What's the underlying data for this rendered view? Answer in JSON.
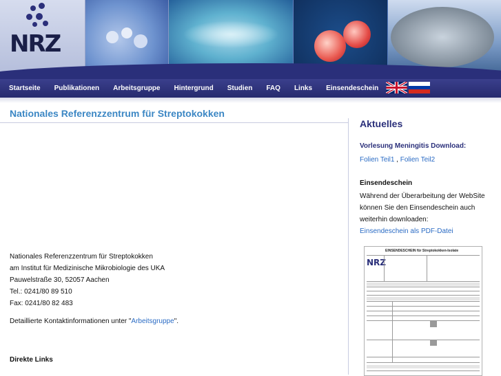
{
  "banner": {
    "logo_text": "NRZ"
  },
  "nav": {
    "items": [
      "Startseite",
      "Publikationen",
      "Arbeitsgruppe",
      "Hintergrund",
      "Studien",
      "FAQ",
      "Links",
      "Einsendeschein"
    ],
    "flags": [
      "uk-flag-icon",
      "russia-flag-icon"
    ]
  },
  "main": {
    "title": "Nationales Referenzzentrum für Streptokokken",
    "address": [
      "Nationales Referenzzentrum für Streptokokken",
      "am Institut für Medizinische Mikrobiologie des UKA",
      "Pauwelstraße 30, 52057 Aachen",
      "Tel.: 0241/80 89 510",
      "Fax: 0241/80 82 483"
    ],
    "kontakt_prefix": "Detaillierte Kontaktinformationen unter \"",
    "kontakt_link": "Arbeitsgruppe",
    "kontakt_suffix": "\".",
    "direkte_links": "Direkte Links"
  },
  "sidebar": {
    "heading": "Aktuelles",
    "vorlesung": "Vorlesung Meningitis Download:",
    "folie1": "Folien Teil1",
    "folien_sep": " , ",
    "folie2": "Folien Teil2",
    "einsend_heading": "Einsendeschein",
    "einsend_lines": [
      "Während der Überarbeitung der WebSite",
      "können Sie den Einsendeschein auch",
      "weiterhin downloaden:"
    ],
    "pdf_link": "Einsendeschein als PDF-Datei",
    "form_title": "EINSENDESCHEIN für Streptokokken-Isolate",
    "form_logo": "NRZ"
  },
  "colors": {
    "nav_bg": "#2a2f7a",
    "title": "#3c87c4",
    "link": "#2a6bc4",
    "sidebar_heading": "#2a2f7a"
  }
}
